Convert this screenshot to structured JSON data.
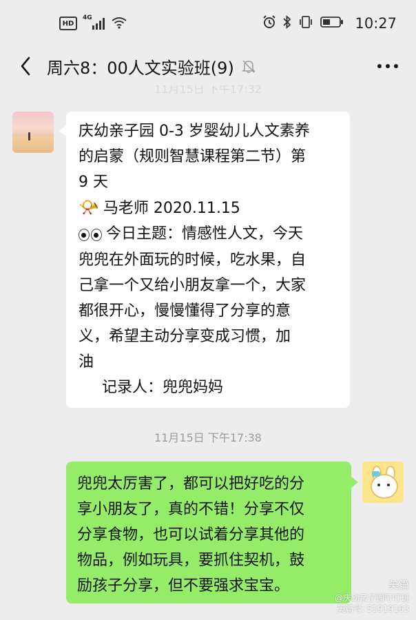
{
  "status_bar": {
    "hd": "HD",
    "network": "4G",
    "time": "10:27",
    "icons": [
      "hd-icon",
      "signal-icon",
      "wifi-icon",
      "alarm-icon",
      "bluetooth-icon",
      "vibrate-icon",
      "battery-icon"
    ]
  },
  "header": {
    "title": "周六8：00人文实验班(9)",
    "icons": [
      "back-icon",
      "mute-bell-icon",
      "more-icon"
    ]
  },
  "chat": {
    "hidden_timestamp": "11月15日 下午17:32",
    "messages": [
      {
        "side": "left",
        "lines": [
          "庆幼亲子园 0-3 岁婴幼儿人文素养",
          "的启蒙（规则智慧课程第二节）第",
          "9 天",
          "马老师 2020.11.15",
          "今日主题：情感性人文，今天",
          "兜兜在外面玩的时候，吃水果，自",
          "己拿一个又给小朋友拿一个，大家",
          "都很开心，慢慢懂得了分享的意",
          "义，希望主动分享变成习惯，加",
          "油",
          "记录人：兜兜妈妈"
        ],
        "icons": [
          "speaker-icon",
          "eyes-icon"
        ]
      },
      {
        "timestamp": "11月15日 下午17:38"
      },
      {
        "side": "right",
        "lines": [
          "兜兜太厉害了，都可以把好吃的分",
          "享小朋友了，真的不错！分享不仅",
          "分享食物，也可以试着分享其他的",
          "物品，例如玩具，要抓住契机，鼓",
          "励孩子分享，但不要强求宝宝。"
        ]
      }
    ]
  },
  "watermark": {
    "logo": "美篇",
    "line1": "@庆幼亲子园叮叮班",
    "line2": "美篇号: 51919163"
  },
  "colors": {
    "background": "#ededed",
    "incoming_bubble": "#ffffff",
    "outgoing_bubble": "#95ec69",
    "timestamp": "#9b9b9b"
  }
}
